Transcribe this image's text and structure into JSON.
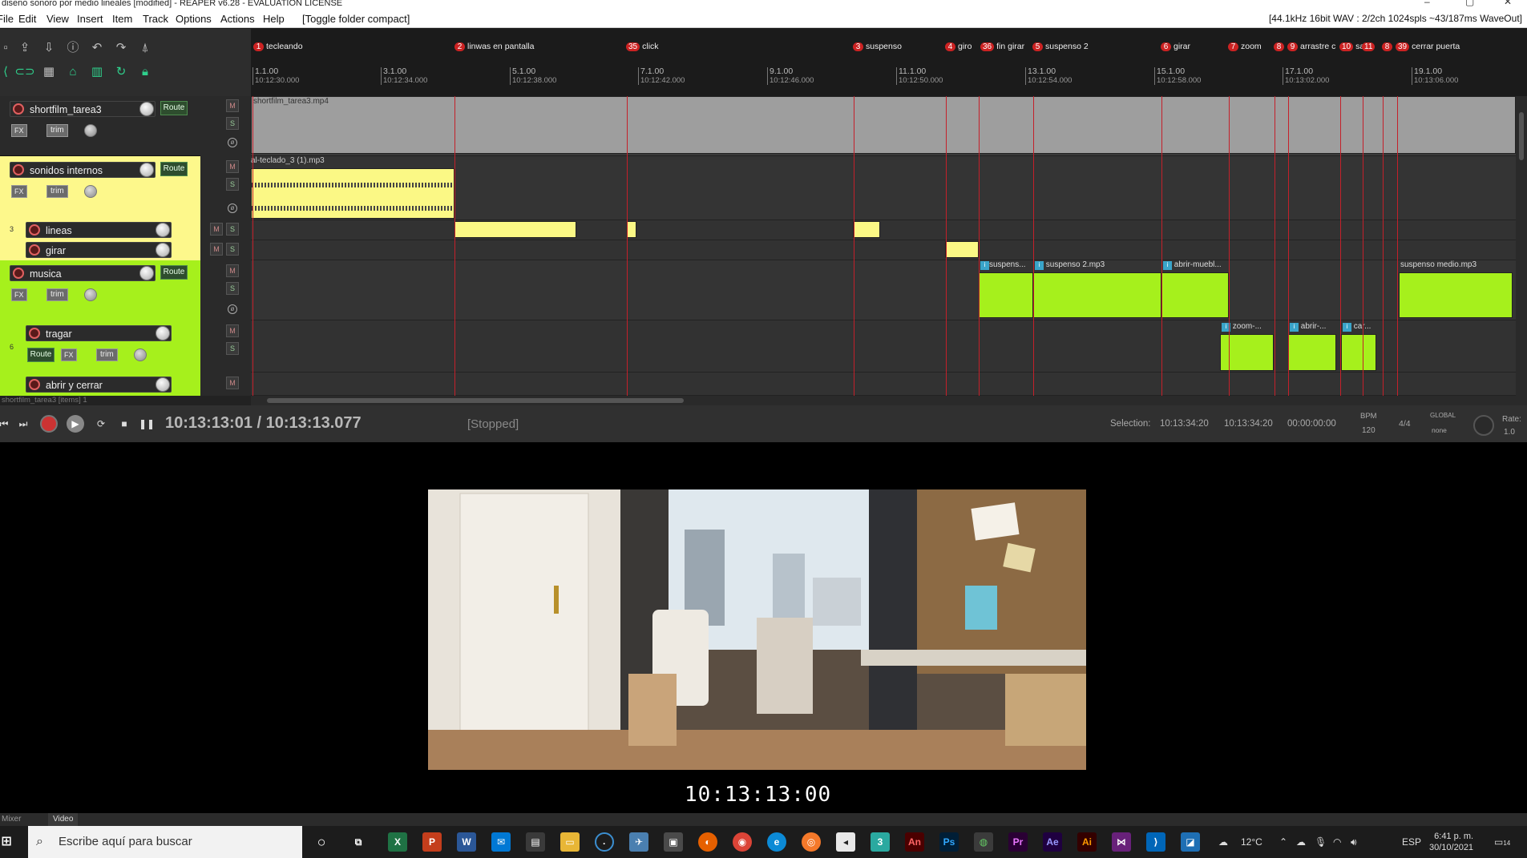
{
  "window": {
    "title": "diseno sonoro por medio lineales [modified] - REAPER v6.28 - EVALUATION LICENSE",
    "audio_info": "[44.1kHz 16bit WAV : 2/2ch 1024spls ~43/187ms WaveOut]"
  },
  "menu": [
    "File",
    "Edit",
    "View",
    "Insert",
    "Item",
    "Track",
    "Options",
    "Actions",
    "Help",
    "[Toggle folder compact]"
  ],
  "tracks": [
    {
      "name": "shortfilm_tarea3",
      "color": "#2e2e2e",
      "has_route": true
    },
    {
      "name": "sonidos internos",
      "color": "#fdf88b",
      "has_route": true
    },
    {
      "name": "lineas",
      "color": "#fdf88b",
      "has_route": false
    },
    {
      "name": "girar",
      "color": "#fdf88b",
      "has_route": false
    },
    {
      "name": "musica",
      "color": "#a6f01c",
      "has_route": true
    },
    {
      "name": "tragar",
      "color": "#a6f01c",
      "has_route": true
    },
    {
      "name": "abrir y cerrar",
      "color": "#a6f01c",
      "has_route": false
    }
  ],
  "buttons": {
    "route": "Route",
    "fx": "FX",
    "trim": "trim",
    "mute": "M",
    "solo": "S"
  },
  "markers": [
    {
      "num": "1",
      "label": "tecleando"
    },
    {
      "num": "2",
      "label": "linwas en pantalla"
    },
    {
      "num": "35",
      "label": "click"
    },
    {
      "num": "3",
      "label": "suspenso"
    },
    {
      "num": "4",
      "label": "giro"
    },
    {
      "num": "36",
      "label": "fin girar"
    },
    {
      "num": "5",
      "label": "suspenso 2"
    },
    {
      "num": "6",
      "label": "girar"
    },
    {
      "num": "7",
      "label": "zoom"
    },
    {
      "num": "8",
      "label": ""
    },
    {
      "num": "9",
      "label": "arrastre c"
    },
    {
      "num": "10",
      "label": "sa"
    },
    {
      "num": "11",
      "label": ""
    },
    {
      "num": "8",
      "label": ""
    },
    {
      "num": "39",
      "label": "cerrar puerta"
    }
  ],
  "ruler": [
    {
      "bar": "1.1.00",
      "time": "10:12:30.000"
    },
    {
      "bar": "3.1.00",
      "time": "10:12:34.000"
    },
    {
      "bar": "5.1.00",
      "time": "10:12:38.000"
    },
    {
      "bar": "7.1.00",
      "time": "10:12:42.000"
    },
    {
      "bar": "9.1.00",
      "time": "10:12:46.000"
    },
    {
      "bar": "11.1.00",
      "time": "10:12:50.000"
    },
    {
      "bar": "13.1.00",
      "time": "10:12:54.000"
    },
    {
      "bar": "15.1.00",
      "time": "10:12:58.000"
    },
    {
      "bar": "17.1.00",
      "time": "10:13:02.000"
    },
    {
      "bar": "19.1.00",
      "time": "10:13:06.000"
    }
  ],
  "items": {
    "video": "shortfilm_tarea3.mp4",
    "teclado": "al-teclado_3 (1).mp3",
    "suspenso1": "suspens...",
    "suspenso2": "suspenso 2.mp3",
    "abrir_mueble": "abrir-muebl...",
    "suspenso_medio": "suspenso medio.mp3",
    "zoom": "zoom-...",
    "abrir": "abrir-...",
    "car": "car..."
  },
  "status_strip": "shortfilm_tarea3 [items] 1",
  "transport": {
    "position": "10:13:13:01 / 10:13:13.077",
    "state": "[Stopped]",
    "selection_label": "Selection:",
    "sel_start": "10:13:34:20",
    "sel_end": "10:13:34:20",
    "sel_len": "00:00:00:00",
    "bpm_label": "BPM",
    "bpm": "120",
    "timesig": "4/4",
    "global_label": "GLOBAL",
    "global_val": "none",
    "rate_label": "Rate:",
    "rate": "1.0"
  },
  "video": {
    "timecode": "10:13:13:00"
  },
  "dock_tabs": [
    "Mixer",
    "Video"
  ],
  "taskbar": {
    "search": "Escribe aquí para buscar",
    "weather": "12°C",
    "lang": "ESP",
    "time": "6:41 p. m.",
    "date": "30/10/2021",
    "notif": "14"
  }
}
